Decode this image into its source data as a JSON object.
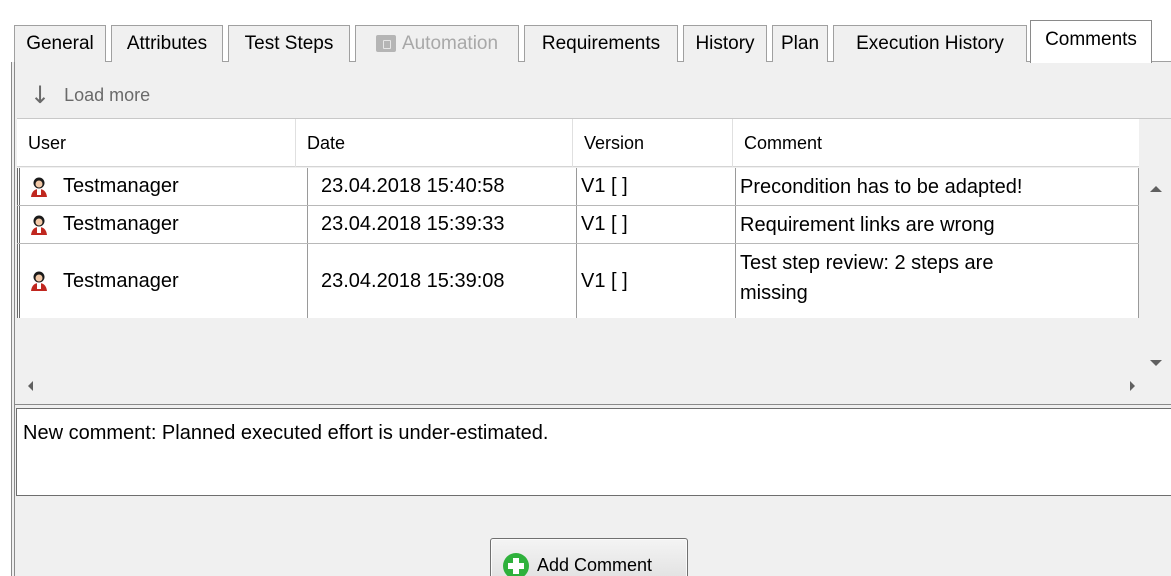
{
  "tabs": [
    {
      "label": "General",
      "state": "normal"
    },
    {
      "label": "Attributes",
      "state": "normal"
    },
    {
      "label": "Test Steps",
      "state": "normal"
    },
    {
      "label": "Automation",
      "state": "disabled"
    },
    {
      "label": "Requirements",
      "state": "normal"
    },
    {
      "label": "History",
      "state": "normal"
    },
    {
      "label": "Plan",
      "state": "normal"
    },
    {
      "label": "Execution History",
      "state": "normal"
    },
    {
      "label": "Comments",
      "state": "active"
    }
  ],
  "load_more": {
    "label": "Load more",
    "icon": "down-arrow-icon"
  },
  "grid": {
    "columns": [
      "User",
      "Date",
      "Version",
      "Comment"
    ],
    "rows": [
      {
        "user": "Testmanager",
        "date": "23.04.2018 15:40:58",
        "version": "V1 [ ]",
        "comment_lines": [
          "Precondition has to be adapted!"
        ]
      },
      {
        "user": "Testmanager",
        "date": "23.04.2018 15:39:33",
        "version": "V1 [ ]",
        "comment_lines": [
          "Requirement links are wrong"
        ]
      },
      {
        "user": "Testmanager",
        "date": "23.04.2018 15:39:08",
        "version": "V1 [ ]",
        "comment_lines": [
          "Test step review: 2 steps are",
          "missing"
        ]
      }
    ]
  },
  "new_comment": {
    "value": "New comment: Planned executed effort is under-estimated."
  },
  "add_button": {
    "label": "Add Comment",
    "icon": "plus-circle-icon",
    "icon_color": "#2fb13c"
  }
}
